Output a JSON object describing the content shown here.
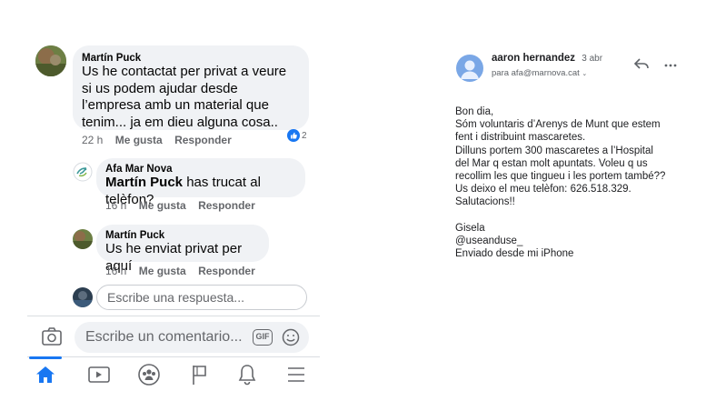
{
  "facebook": {
    "comments": [
      {
        "author": "Martín Puck",
        "text": "Us he contactat per privat a veure si us podem ajudar desde l’empresa amb un material que tenim... ja em dieu alguna cosa..",
        "time": "22 h",
        "like_label": "Me gusta",
        "reply_label": "Responder",
        "reaction_count": "2"
      }
    ],
    "replies": [
      {
        "author": "Afa Mar Nova",
        "mention": "Martín Puck",
        "text": " has trucat al telèfon?",
        "time": "16 h",
        "like_label": "Me gusta",
        "reply_label": "Responder"
      },
      {
        "author": "Martín Puck",
        "text": "Us he enviat privat per aquí",
        "time": "16 h",
        "like_label": "Me gusta",
        "reply_label": "Responder"
      }
    ],
    "reply_placeholder": "Escribe una respuesta...",
    "comment_placeholder": "Escribe un comentario...",
    "gif_label": "GIF",
    "accent_color": "#1877f2",
    "nav_icons": [
      "home-icon",
      "watch-icon",
      "groups-icon",
      "flag-icon",
      "bell-icon",
      "menu-icon"
    ]
  },
  "email": {
    "sender": "aaron hernandez",
    "date": "3 abr",
    "recipient": "para afa@marnova.cat",
    "body": "Bon dia,\nSóm voluntaris d’Arenys de Munt que estem\nfent i distribuint mascaretes.\nDilluns portem 300 mascaretes a l’Hospital\ndel Mar q estan molt apuntats. Voleu q us\nrecollim les que tingueu i les portem també??\nUs deixo el meu telèfon: 626.518.329.\nSalutacions!!\n\nGisela\n@useanduse_\nEnviado desde mi iPhone",
    "avatar_color": "#7aa7e6"
  }
}
